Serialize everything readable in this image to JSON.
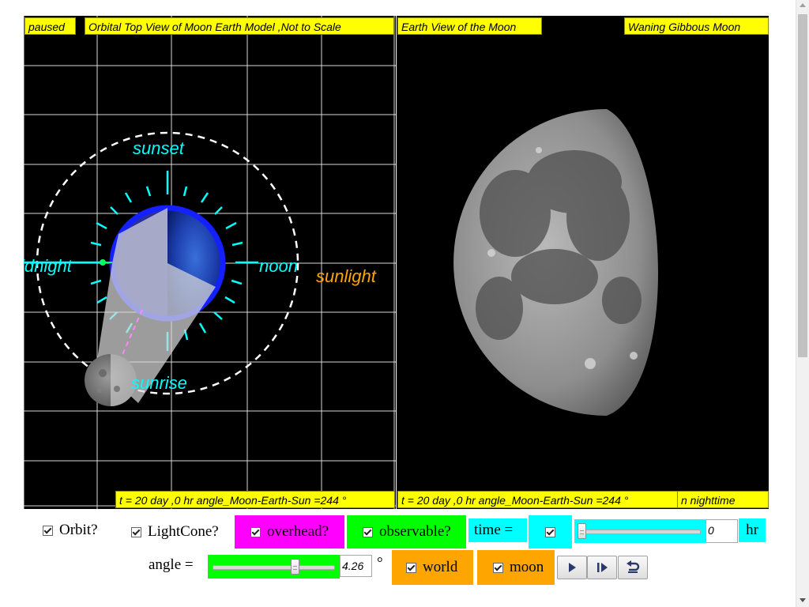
{
  "left_panel": {
    "status": "paused",
    "title": "Orbital Top View of Moon Earth Model ,Not to Scale",
    "labels": {
      "sunset": "sunset",
      "midnight": "idnight",
      "noon": "noon",
      "sunrise": "sunrise",
      "sunlight": "sunlight"
    },
    "footer": "t = 20 day ,0 hr angle_Moon-Earth-Sun =244 °"
  },
  "right_panel": {
    "title": "Earth View of the Moon",
    "phase": "Waning Gibbous Moon",
    "footer": "t = 20 day ,0 hr angle_Moon-Earth-Sun =244 °",
    "nighttime": "n nighttime"
  },
  "controls": {
    "orbit_label": "Orbit?",
    "lightcone_label": "LightCone?",
    "overhead_label": "overhead?",
    "observable_label": "observable?",
    "time_label": "time =",
    "time_value": "0",
    "time_unit": "hr",
    "time_slider_fraction": 0,
    "angle_label": "angle =",
    "angle_value": "4.26",
    "angle_unit": "°",
    "angle_slider_fraction": 0.68,
    "world_label": "world",
    "moon_label": "moon"
  },
  "colors": {
    "yellow_box": "#ffff00",
    "overhead_bg": "#ff00ff",
    "observable_bg": "#00ff00",
    "time_bg": "#00ffff",
    "orange_bg": "#ffa500",
    "cyan_text": "#00ffff",
    "sunlight_text": "#ffa500"
  }
}
